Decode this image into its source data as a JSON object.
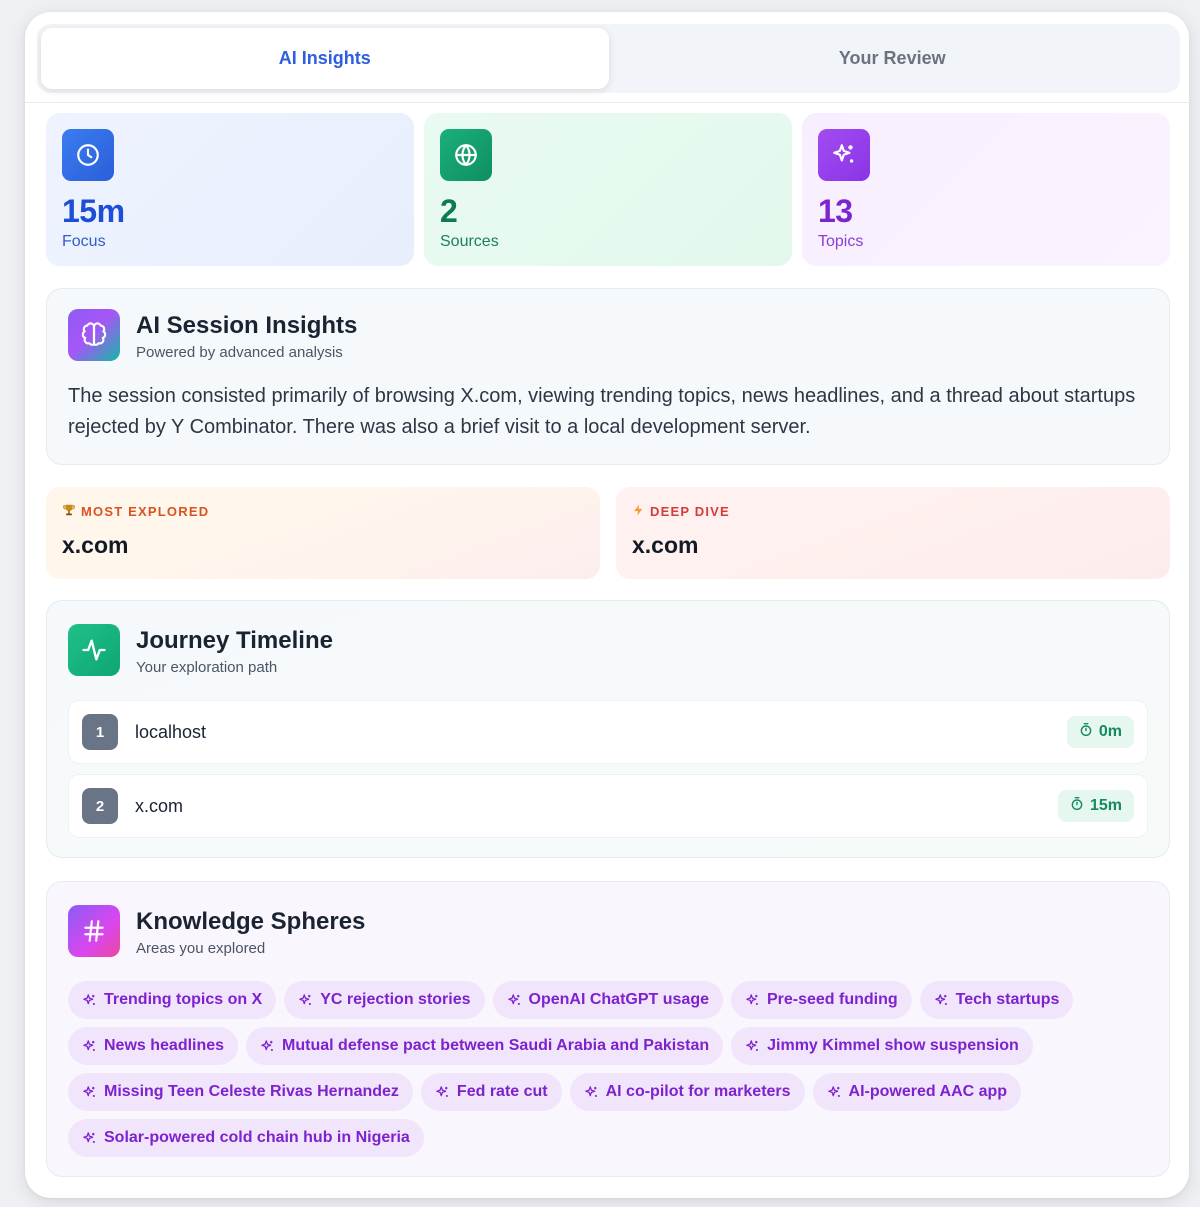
{
  "tabs": [
    {
      "label": "AI Insights",
      "active": true
    },
    {
      "label": "Your Review",
      "active": false
    }
  ],
  "stats": {
    "focus": {
      "value": "15m",
      "label": "Focus",
      "icon": "clock-icon"
    },
    "sources": {
      "value": "2",
      "label": "Sources",
      "icon": "globe-icon"
    },
    "topics": {
      "value": "13",
      "label": "Topics",
      "icon": "sparkles-icon"
    }
  },
  "insights": {
    "title": "AI Session Insights",
    "subtitle": "Powered by advanced analysis",
    "icon": "brain-icon",
    "description": "The session consisted primarily of browsing X.com, viewing trending topics, news headlines, and a thread about startups rejected by Y Combinator. There was also a brief visit to a local development server."
  },
  "highlights": {
    "most_explored": {
      "tag": "MOST EXPLORED",
      "icon": "trophy-icon",
      "domain": "x.com"
    },
    "deep_dive": {
      "tag": "DEEP DIVE",
      "icon": "lightning-icon",
      "domain": "x.com"
    }
  },
  "journey": {
    "title": "Journey Timeline",
    "subtitle": "Your exploration path",
    "icon": "activity-icon",
    "steps": [
      {
        "num": "1",
        "host": "localhost",
        "duration": "0m"
      },
      {
        "num": "2",
        "host": "x.com",
        "duration": "15m"
      }
    ]
  },
  "knowledge": {
    "title": "Knowledge Spheres",
    "subtitle": "Areas you explored",
    "icon": "hash-icon",
    "topics": [
      "Trending topics on X",
      "YC rejection stories",
      "OpenAI ChatGPT usage",
      "Pre-seed funding",
      "Tech startups",
      "News headlines",
      "Mutual defense pact between Saudi Arabia and Pakistan",
      "Jimmy Kimmel show suspension",
      "Missing Teen Celeste Rivas Hernandez",
      "Fed rate cut",
      "AI co-pilot for marketers",
      "AI-powered AAC app",
      "Solar-powered cold chain hub in Nigeria"
    ]
  },
  "colors": {
    "accent_blue": "#2f5ee0",
    "green": "#0d7a53",
    "purple": "#7c25cf",
    "orange": "#d9531e",
    "red": "#d43c3c"
  }
}
